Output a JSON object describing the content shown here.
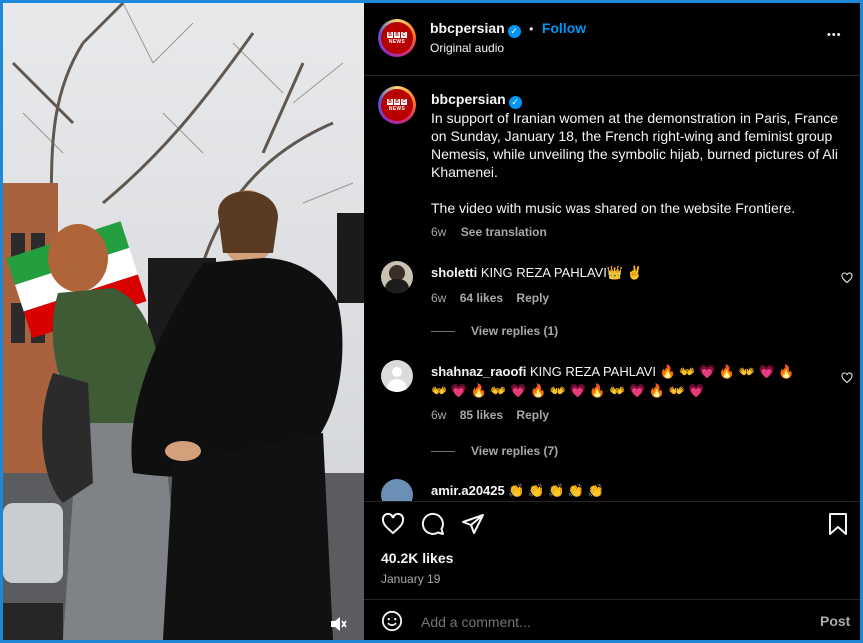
{
  "header": {
    "username": "bbcpersian",
    "separator": "•",
    "follow_label": "Follow",
    "audio": "Original audio",
    "more": "•••"
  },
  "post": {
    "username": "bbcpersian",
    "caption_p1": "In support of Iranian women at the demonstration in Paris, France on Sunday, January 18, the French right-wing and feminist group Nemesis, while unveiling the symbolic hijab, burned pictures of Ali Khamenei.",
    "caption_p2": "The video with music was shared on the website Frontiere.",
    "age": "6w",
    "see_translation": "See translation"
  },
  "comments": [
    {
      "username": "sholetti",
      "text": "KING REZA PAHLAVI👑 ✌",
      "age": "6w",
      "likes": "64 likes",
      "reply": "Reply",
      "view_replies": "View replies (1)"
    },
    {
      "username": "shahnaz_raoofi",
      "text": "KING REZA PAHLAVI 🔥 👐 💗 🔥 👐 💗 🔥 👐 💗 🔥 👐 💗 🔥 👐 💗 🔥 👐 💗 🔥 👐 💗",
      "age": "6w",
      "likes": "85 likes",
      "reply": "Reply",
      "view_replies": "View replies (7)"
    },
    {
      "username": "amir.a20425",
      "text": "👏 👏 👏 👏 👏"
    }
  ],
  "stats": {
    "likes": "40.2K likes",
    "date": "January 19"
  },
  "comment_box": {
    "placeholder": "Add a comment...",
    "post_label": "Post"
  },
  "colors": {
    "accent": "#0095f6",
    "background": "#000000",
    "text": "#f5f5f5",
    "muted": "#a8a8a8"
  }
}
